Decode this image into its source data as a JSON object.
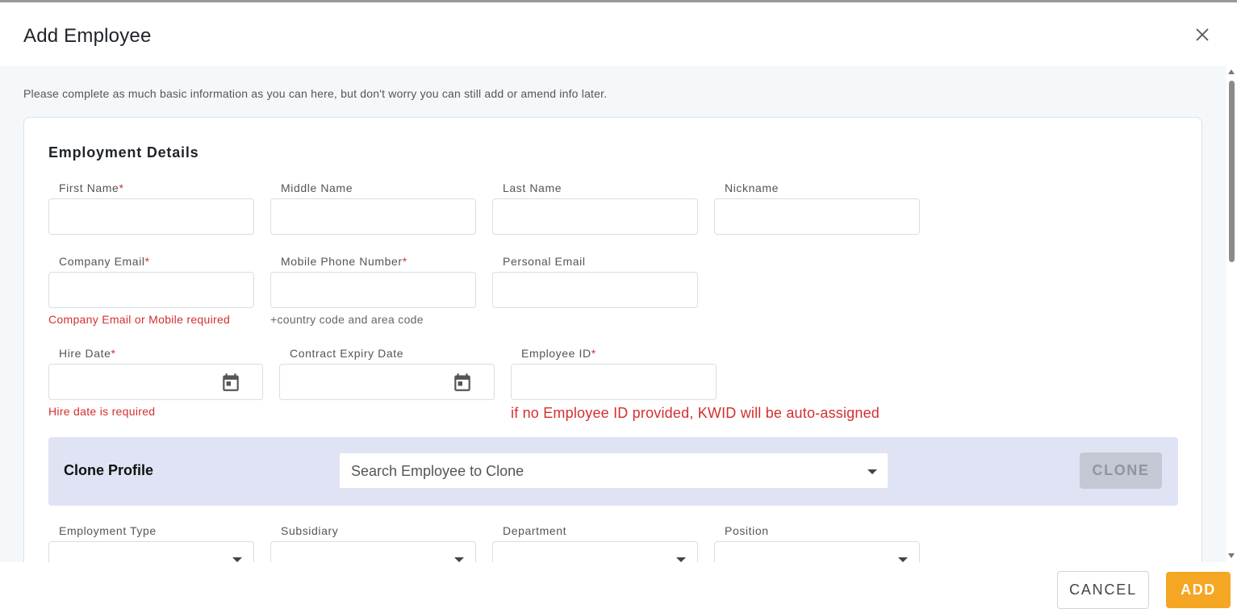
{
  "dialog": {
    "title": "Add Employee"
  },
  "intro": "Please complete as much basic information as you can here, but don't worry you can still add or amend info later.",
  "section": {
    "title": "Employment Details"
  },
  "fields": {
    "first_name": {
      "label": "First Name",
      "required": "*",
      "value": ""
    },
    "middle_name": {
      "label": "Middle Name",
      "value": ""
    },
    "last_name": {
      "label": "Last Name",
      "value": ""
    },
    "nickname": {
      "label": "Nickname",
      "value": ""
    },
    "company_email": {
      "label": "Company Email",
      "required": "*",
      "value": "",
      "error": "Company Email or Mobile required"
    },
    "mobile_phone": {
      "label": "Mobile Phone Number",
      "required": "*",
      "value": "",
      "helper": "+country code and area code"
    },
    "personal_email": {
      "label": "Personal Email",
      "value": ""
    },
    "hire_date": {
      "label": "Hire Date",
      "required": "*",
      "value": "",
      "error": "Hire date is required"
    },
    "contract_expiry": {
      "label": "Contract Expiry Date",
      "value": ""
    },
    "employee_id": {
      "label": "Employee ID",
      "required": "*",
      "value": "",
      "error": "if no Employee ID provided, KWID will be auto-assigned"
    },
    "employment_type": {
      "label": "Employment Type",
      "value": ""
    },
    "subsidiary": {
      "label": "Subsidiary",
      "value": ""
    },
    "department": {
      "label": "Department",
      "value": ""
    },
    "position": {
      "label": "Position",
      "value": ""
    }
  },
  "clone": {
    "label": "Clone Profile",
    "placeholder": "Search Employee to Clone",
    "button": "CLONE"
  },
  "footer": {
    "cancel": "CANCEL",
    "add": "ADD"
  },
  "colors": {
    "accent": "#f5a623",
    "error": "#d32f2f",
    "clone_bg": "#dfe3f4"
  },
  "icons": {
    "close": "close-icon",
    "calendar": "calendar-icon",
    "dropdown": "chevron-down-icon"
  }
}
